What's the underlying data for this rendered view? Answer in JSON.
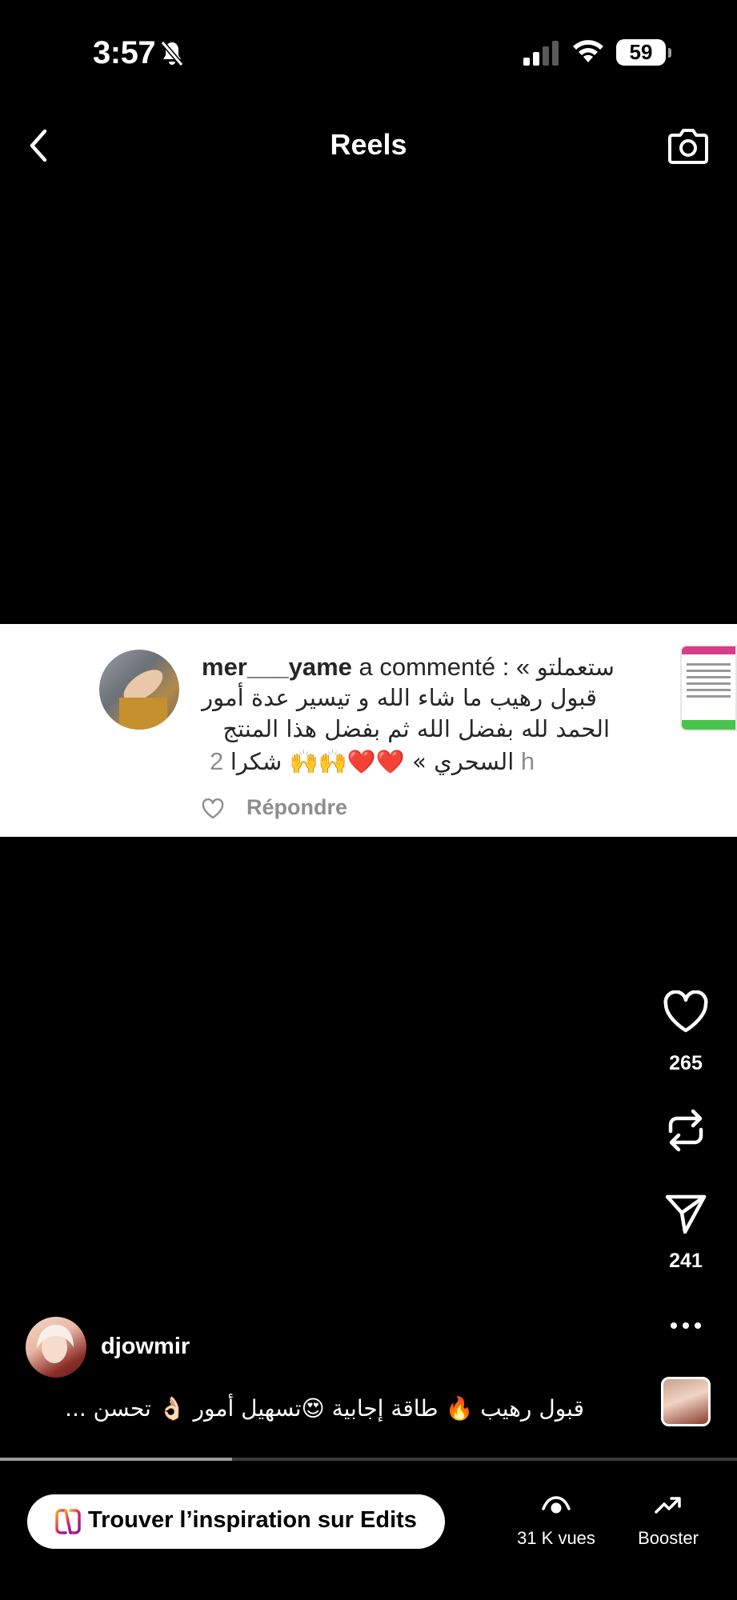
{
  "status_bar": {
    "time": "3:57",
    "battery": "59"
  },
  "header": {
    "title": "Reels"
  },
  "comment": {
    "username": "mer___yame",
    "action": " a commenté : «",
    "text_line1": "ستعملتو",
    "text_line2": "قبول رهيب ما شاء الله و تيسير عدة أمور",
    "text_line3": "الحمد لله بفضل الله ثم بفضل هذا المنتج",
    "text_line4": "السحري » ❤️❤️🙌🙌 شكرا",
    "time": "2 h",
    "reply_label": "Répondre"
  },
  "actions": {
    "likes": "265",
    "shares": "241"
  },
  "post": {
    "username": "djowmir",
    "caption": "قبول رهيب 🔥 طاقة إجابية 😍تسهيل أمور 👌🏻 تحسن ..."
  },
  "progress": {
    "fraction": 0.315
  },
  "bottom": {
    "edits_label": "Trouver l’inspiration sur Edits",
    "views_label": "31 K vues",
    "boost_label": "Booster"
  }
}
